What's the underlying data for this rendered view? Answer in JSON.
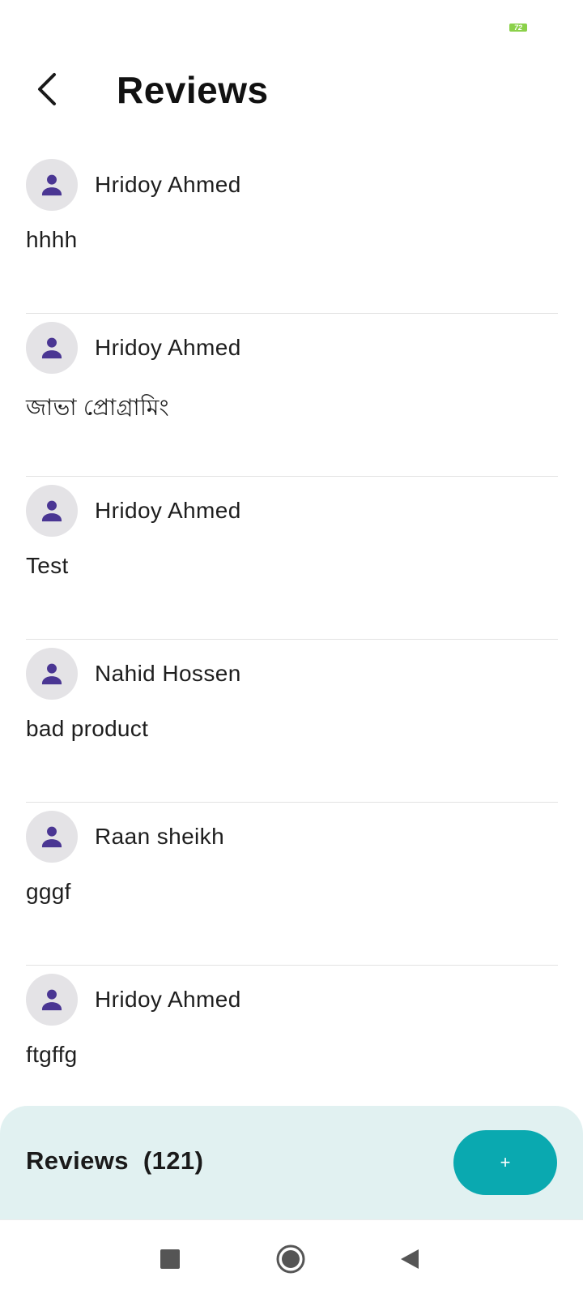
{
  "status_bar": {
    "battery_level": "72",
    "battery_color": "#8bd14a"
  },
  "header": {
    "back_icon": "chevron-left-icon",
    "title": "Reviews"
  },
  "reviews": [
    {
      "name": "Hridoy Ahmed",
      "comment": "hhhh"
    },
    {
      "name": "Hridoy Ahmed",
      "comment": "জাভা প্রোগ্রামিং"
    },
    {
      "name": "Hridoy Ahmed",
      "comment": "Test"
    },
    {
      "name": "Nahid Hossen",
      "comment": "bad product"
    },
    {
      "name": "Raan sheikh",
      "comment": "gggf"
    },
    {
      "name": "Hridoy Ahmed",
      "comment": "ftgffg"
    }
  ],
  "footer": {
    "label": "Reviews",
    "count": "(121)",
    "add_label": "+",
    "panel_color": "#e1f1f1",
    "add_button_color": "#0aa9b0"
  },
  "colors": {
    "avatar_bg": "#e4e3e6",
    "avatar_icon": "#4a3693"
  },
  "nav_bar": {
    "icons": [
      "recents-square-icon",
      "home-circle-icon",
      "back-triangle-icon"
    ]
  }
}
